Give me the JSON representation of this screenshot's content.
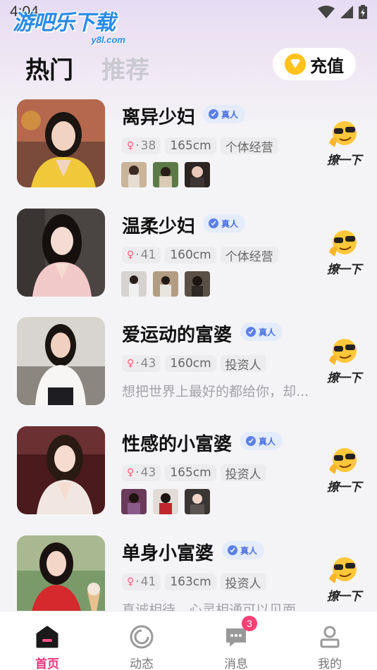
{
  "status": {
    "time": "4:04"
  },
  "watermark": {
    "title": "游吧乐下载",
    "sub": "y8l.com"
  },
  "header": {
    "tabs": [
      {
        "label": "热门"
      },
      {
        "label": "推荐"
      }
    ],
    "recharge_label": "充值"
  },
  "cards": [
    {
      "name": "离异少妇",
      "verified": "真人",
      "age": "38",
      "height": "165cm",
      "job": "个体经营",
      "greet": "撩一下",
      "bio": "",
      "photos": 3
    },
    {
      "name": "温柔少妇",
      "verified": "真人",
      "age": "41",
      "height": "160cm",
      "job": "个体经营",
      "greet": "撩一下",
      "bio": "",
      "photos": 3
    },
    {
      "name": "爱运动的富婆",
      "verified": "真人",
      "age": "43",
      "height": "160cm",
      "job": "投资人",
      "greet": "撩一下",
      "bio": "想把世界上最好的都给你，却...",
      "photos": 0
    },
    {
      "name": "性感的小富婆",
      "verified": "真人",
      "age": "43",
      "height": "165cm",
      "job": "投资人",
      "greet": "撩一下",
      "bio": "",
      "photos": 3
    },
    {
      "name": "单身小富婆",
      "verified": "真人",
      "age": "41",
      "height": "163cm",
      "job": "投资人",
      "greet": "撩一下",
      "bio": "真诚相待，心灵相通可以见面",
      "photos": 0
    }
  ],
  "nav": {
    "items": [
      {
        "label": "首页",
        "icon": "home-icon",
        "active": true
      },
      {
        "label": "动态",
        "icon": "moments-icon",
        "active": false
      },
      {
        "label": "消息",
        "icon": "message-icon",
        "active": false,
        "badge": "3"
      },
      {
        "label": "我的",
        "icon": "profile-icon",
        "active": false
      }
    ]
  },
  "colors": {
    "accent": "#e8357a",
    "verified": "#5b7ee8",
    "coin": "#ffc21a"
  }
}
